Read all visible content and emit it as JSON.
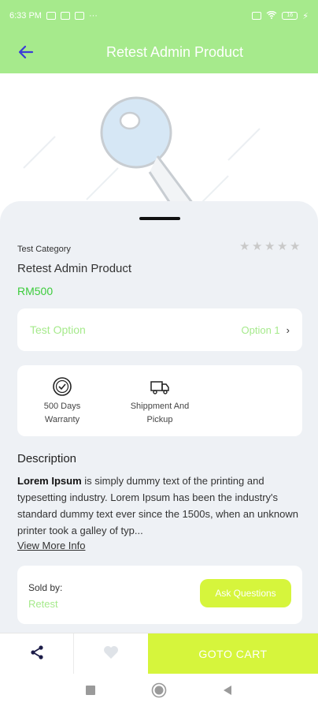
{
  "status_bar": {
    "time": "6:33 PM",
    "battery": "16"
  },
  "header": {
    "title": "Retest Admin Product"
  },
  "product": {
    "category": "Test Category",
    "name": "Retest Admin Product",
    "price": "RM500",
    "rating": 0,
    "option_label": "Test Option",
    "option_value": "Option 1"
  },
  "features": [
    {
      "icon": "badge-check-icon",
      "label_line1": "500 Days",
      "label_line2": "Warranty"
    },
    {
      "icon": "truck-icon",
      "label_line1": "Shippment And",
      "label_line2": "Pickup"
    }
  ],
  "description": {
    "title": "Description",
    "bold_lead": "Lorem Ipsum",
    "text": " is simply dummy text of the printing and typesetting industry. Lorem Ipsum has been the industry's standard dummy text ever since the 1500s, when an unknown printer took a galley of typ...",
    "view_more": "View More Info"
  },
  "seller": {
    "sold_by_label": "Sold by:",
    "name": "Retest",
    "ask_button": "Ask Questions"
  },
  "bottom_bar": {
    "cart_label": "GOTO CART"
  },
  "colors": {
    "primary": "#a6ea8c",
    "accent": "#d6f53c",
    "price": "#3ccc3c",
    "sheet": "#eef1f5"
  }
}
